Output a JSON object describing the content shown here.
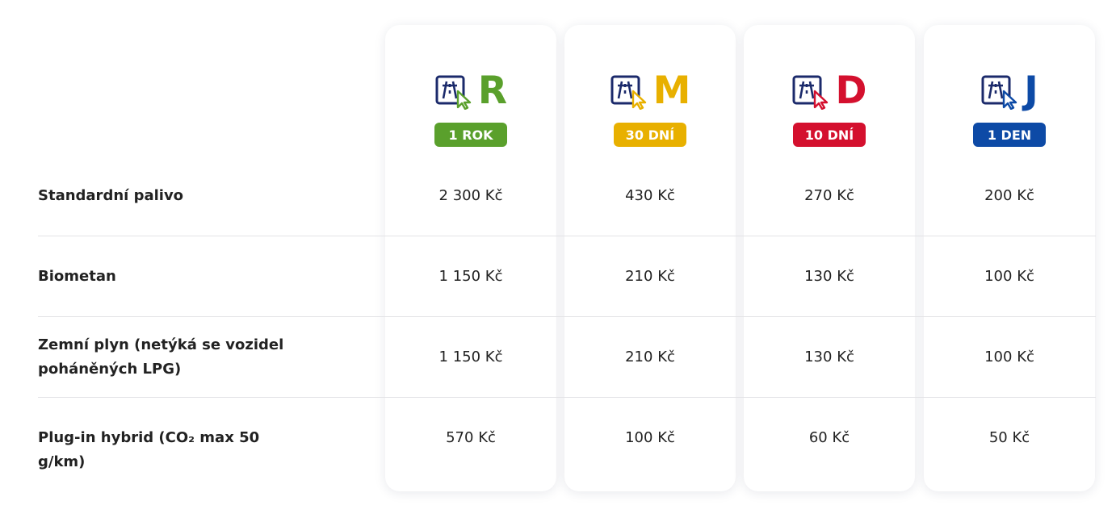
{
  "plans": [
    {
      "letter": "R",
      "badge": "1 ROK",
      "color": "#5aa02c"
    },
    {
      "letter": "M",
      "badge": "30 DNÍ",
      "color": "#e8b000"
    },
    {
      "letter": "D",
      "badge": "10 DNÍ",
      "color": "#d4102e"
    },
    {
      "letter": "J",
      "badge": "1 DEN",
      "color": "#0d4aa6"
    }
  ],
  "icon_color": "#1b2a6b",
  "rows": [
    {
      "label": "Standardní palivo",
      "prices": [
        "2 300 Kč",
        "430 Kč",
        "270 Kč",
        "200 Kč"
      ]
    },
    {
      "label": "Biometan",
      "prices": [
        "1 150 Kč",
        "210 Kč",
        "130 Kč",
        "100 Kč"
      ]
    },
    {
      "label": "Zemní plyn (netýká se vozidel poháněných LPG)",
      "prices": [
        "1 150 Kč",
        "210 Kč",
        "130 Kč",
        "100 Kč"
      ]
    },
    {
      "label": "Plug-in hybrid (CO₂ max 50 g/km)",
      "prices": [
        "570 Kč",
        "100 Kč",
        "60 Kč",
        "50 Kč"
      ]
    }
  ]
}
